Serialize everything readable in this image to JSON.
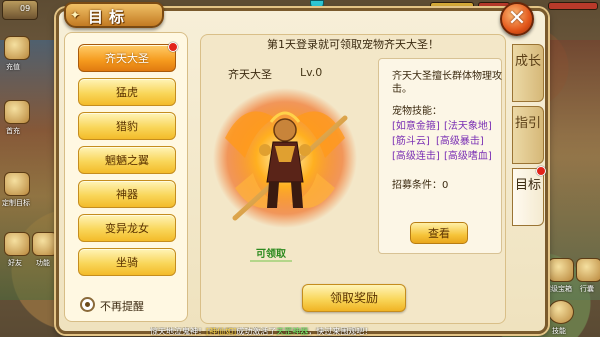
{
  "title": "目标",
  "close_label": "✕",
  "hud": {
    "level": "09"
  },
  "list_items": [
    {
      "label": "齐天大圣",
      "active": true,
      "badge": true
    },
    {
      "label": "猛虎",
      "active": false,
      "badge": false
    },
    {
      "label": "猎豹",
      "active": false,
      "badge": false
    },
    {
      "label": "魍魉之翼",
      "active": false,
      "badge": false
    },
    {
      "label": "神器",
      "active": false,
      "badge": false
    },
    {
      "label": "变异龙女",
      "active": false,
      "badge": false
    },
    {
      "label": "坐骑",
      "active": false,
      "badge": false
    }
  ],
  "no_remind_label": "不再提醒",
  "content": {
    "headline": "第1天登录就可领取宠物齐天大圣！",
    "pet_name": "齐天大圣",
    "pet_level": "Lv.0",
    "claimable": "可领取",
    "description": "齐天大圣擅长群体物理攻击。",
    "skills_title": "宠物技能：",
    "skills": [
      "[如意金箍]",
      "[法天象地]",
      "[筋斗云]",
      "[高级暴击]",
      "[高级连击]",
      "[高级嗜血]"
    ],
    "recruit_condition": "招募条件：0",
    "view_button": "查看",
    "claim_button": "领取奖励"
  },
  "side_tabs": [
    {
      "label": "成长",
      "active": false
    },
    {
      "label": "指引",
      "active": false
    },
    {
      "label": "目标",
      "active": true,
      "badge": true
    }
  ],
  "ticker": {
    "prefix": "惊天地泣鬼神！",
    "name": "[神仙如]",
    "middle": "成功激活了",
    "item": "天罡神器",
    "suffix": "，快过来围观吧！"
  },
  "side_hud": [
    {
      "label": "充值"
    },
    {
      "label": "首充"
    },
    {
      "label": "定制目标"
    },
    {
      "label": "好友"
    },
    {
      "label": "功能"
    },
    {
      "label": "超级宝箱"
    },
    {
      "label": "行囊"
    },
    {
      "label": "技能"
    }
  ]
}
